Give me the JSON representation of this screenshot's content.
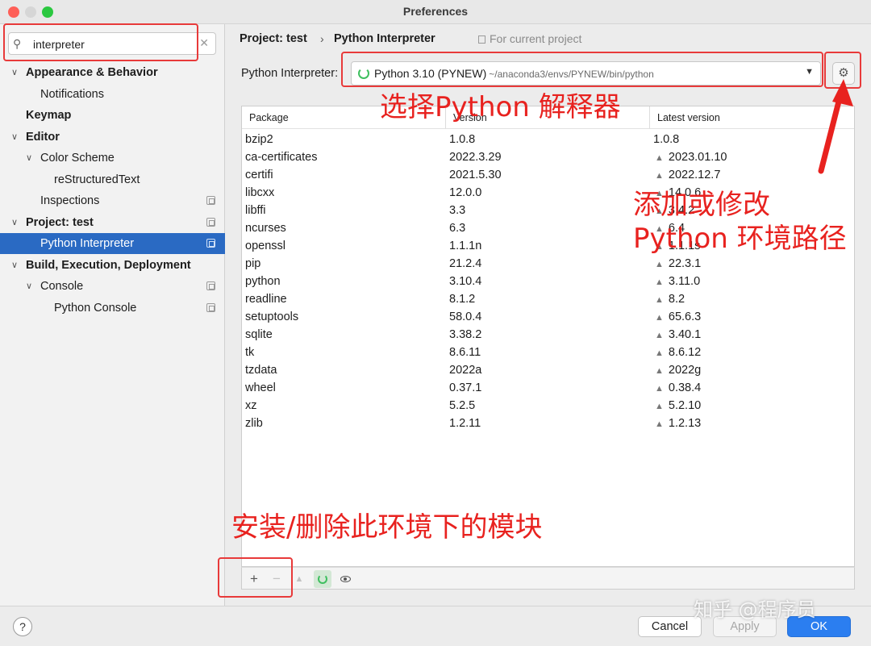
{
  "window": {
    "title": "Preferences"
  },
  "sidebar": {
    "search_value": "interpreter",
    "tree": [
      {
        "label": "Appearance & Behavior",
        "bold": true,
        "expanded": true,
        "level": 0
      },
      {
        "label": "Notifications",
        "bold": false,
        "level": 1
      },
      {
        "label": "Keymap",
        "bold": true,
        "level": 0
      },
      {
        "label": "Editor",
        "bold": true,
        "expanded": true,
        "level": 0
      },
      {
        "label": "Color Scheme",
        "bold": false,
        "expanded": true,
        "level": 1
      },
      {
        "label": "reStructuredText",
        "bold": false,
        "level": 2
      },
      {
        "label": "Inspections",
        "bold": false,
        "level": 1,
        "page_icon": true
      },
      {
        "label": "Project: test",
        "bold": true,
        "expanded": true,
        "level": 0,
        "page_icon": true
      },
      {
        "label": "Python Interpreter",
        "bold": false,
        "level": 1,
        "page_icon": true,
        "selected": true
      },
      {
        "label": "Build, Execution, Deployment",
        "bold": true,
        "expanded": true,
        "level": 0
      },
      {
        "label": "Console",
        "bold": false,
        "expanded": true,
        "level": 1,
        "page_icon": true
      },
      {
        "label": "Python Console",
        "bold": false,
        "level": 2,
        "page_icon": true
      }
    ]
  },
  "header": {
    "breadcrumb_project": "Project: test",
    "breadcrumb_separator": "›",
    "breadcrumb_page": "Python Interpreter",
    "for_current_project": "For current project"
  },
  "interpreter": {
    "label": "Python Interpreter:",
    "name": "Python 3.10 (PYNEW)",
    "path": "~/anaconda3/envs/PYNEW/bin/python"
  },
  "packages": {
    "columns": [
      "Package",
      "Version",
      "Latest version"
    ],
    "rows": [
      {
        "name": "bzip2",
        "version": "1.0.8",
        "latest": "1.0.8",
        "upgrade": false
      },
      {
        "name": "ca-certificates",
        "version": "2022.3.29",
        "latest": "2023.01.10",
        "upgrade": true
      },
      {
        "name": "certifi",
        "version": "2021.5.30",
        "latest": "2022.12.7",
        "upgrade": true
      },
      {
        "name": "libcxx",
        "version": "12.0.0",
        "latest": "14.0.6",
        "upgrade": true
      },
      {
        "name": "libffi",
        "version": "3.3",
        "latest": "3.4.2",
        "upgrade": true
      },
      {
        "name": "ncurses",
        "version": "6.3",
        "latest": "6.4",
        "upgrade": true
      },
      {
        "name": "openssl",
        "version": "1.1.1n",
        "latest": "1.1.1s",
        "upgrade": true
      },
      {
        "name": "pip",
        "version": "21.2.4",
        "latest": "22.3.1",
        "upgrade": true
      },
      {
        "name": "python",
        "version": "3.10.4",
        "latest": "3.11.0",
        "upgrade": true
      },
      {
        "name": "readline",
        "version": "8.1.2",
        "latest": "8.2",
        "upgrade": true
      },
      {
        "name": "setuptools",
        "version": "58.0.4",
        "latest": "65.6.3",
        "upgrade": true
      },
      {
        "name": "sqlite",
        "version": "3.38.2",
        "latest": "3.40.1",
        "upgrade": true
      },
      {
        "name": "tk",
        "version": "8.6.11",
        "latest": "8.6.12",
        "upgrade": true
      },
      {
        "name": "tzdata",
        "version": "2022a",
        "latest": "2022g",
        "upgrade": true
      },
      {
        "name": "wheel",
        "version": "0.37.1",
        "latest": "0.38.4",
        "upgrade": true
      },
      {
        "name": "xz",
        "version": "5.2.5",
        "latest": "5.2.10",
        "upgrade": true
      },
      {
        "name": "zlib",
        "version": "1.2.11",
        "latest": "1.2.13",
        "upgrade": true
      }
    ]
  },
  "toolbar": {
    "add_icon": "plus-icon",
    "remove_icon": "minus-icon",
    "upgrade_icon": "triangle-up-icon",
    "refresh_icon": "refresh-icon",
    "show_early_releases_icon": "eye-icon"
  },
  "footer": {
    "help_label": "?",
    "cancel_label": "Cancel",
    "apply_label": "Apply",
    "ok_label": "OK"
  },
  "annotations": {
    "select_interpreter": "选择Python 解释器",
    "add_or_modify": "添加或修改",
    "env_path": "Python 环境路径",
    "install_remove": "安装/删除此环境下的模块",
    "watermark": "知乎 @程序员"
  },
  "colors": {
    "accent": "#2a6ac3",
    "ok_button": "#2b7ef0",
    "annotation_red": "#e8221f",
    "spinner_green": "#3fbf5f"
  }
}
